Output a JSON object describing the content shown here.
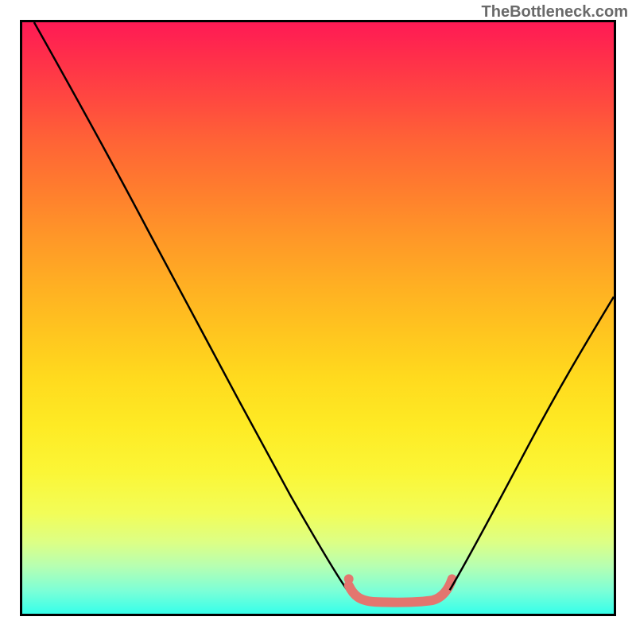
{
  "watermark": "TheBottleneck.com",
  "chart_data": {
    "type": "line",
    "title": "",
    "xlabel": "",
    "ylabel": "",
    "xlim": [
      0,
      100
    ],
    "ylim": [
      0,
      100
    ],
    "series": [
      {
        "name": "black-curve-left",
        "color": "#000000",
        "x": [
          2,
          10,
          20,
          30,
          40,
          50,
          55
        ],
        "values": [
          100,
          86,
          69,
          52,
          34,
          14,
          4
        ]
      },
      {
        "name": "black-curve-right",
        "color": "#000000",
        "x": [
          72,
          78,
          85,
          92,
          99
        ],
        "values": [
          4,
          14,
          27,
          41,
          54
        ]
      },
      {
        "name": "pink-segment",
        "color": "#e3766f",
        "x": [
          55,
          56,
          60,
          66,
          70,
          72
        ],
        "values": [
          5,
          3,
          2,
          2,
          3,
          6
        ]
      }
    ]
  }
}
